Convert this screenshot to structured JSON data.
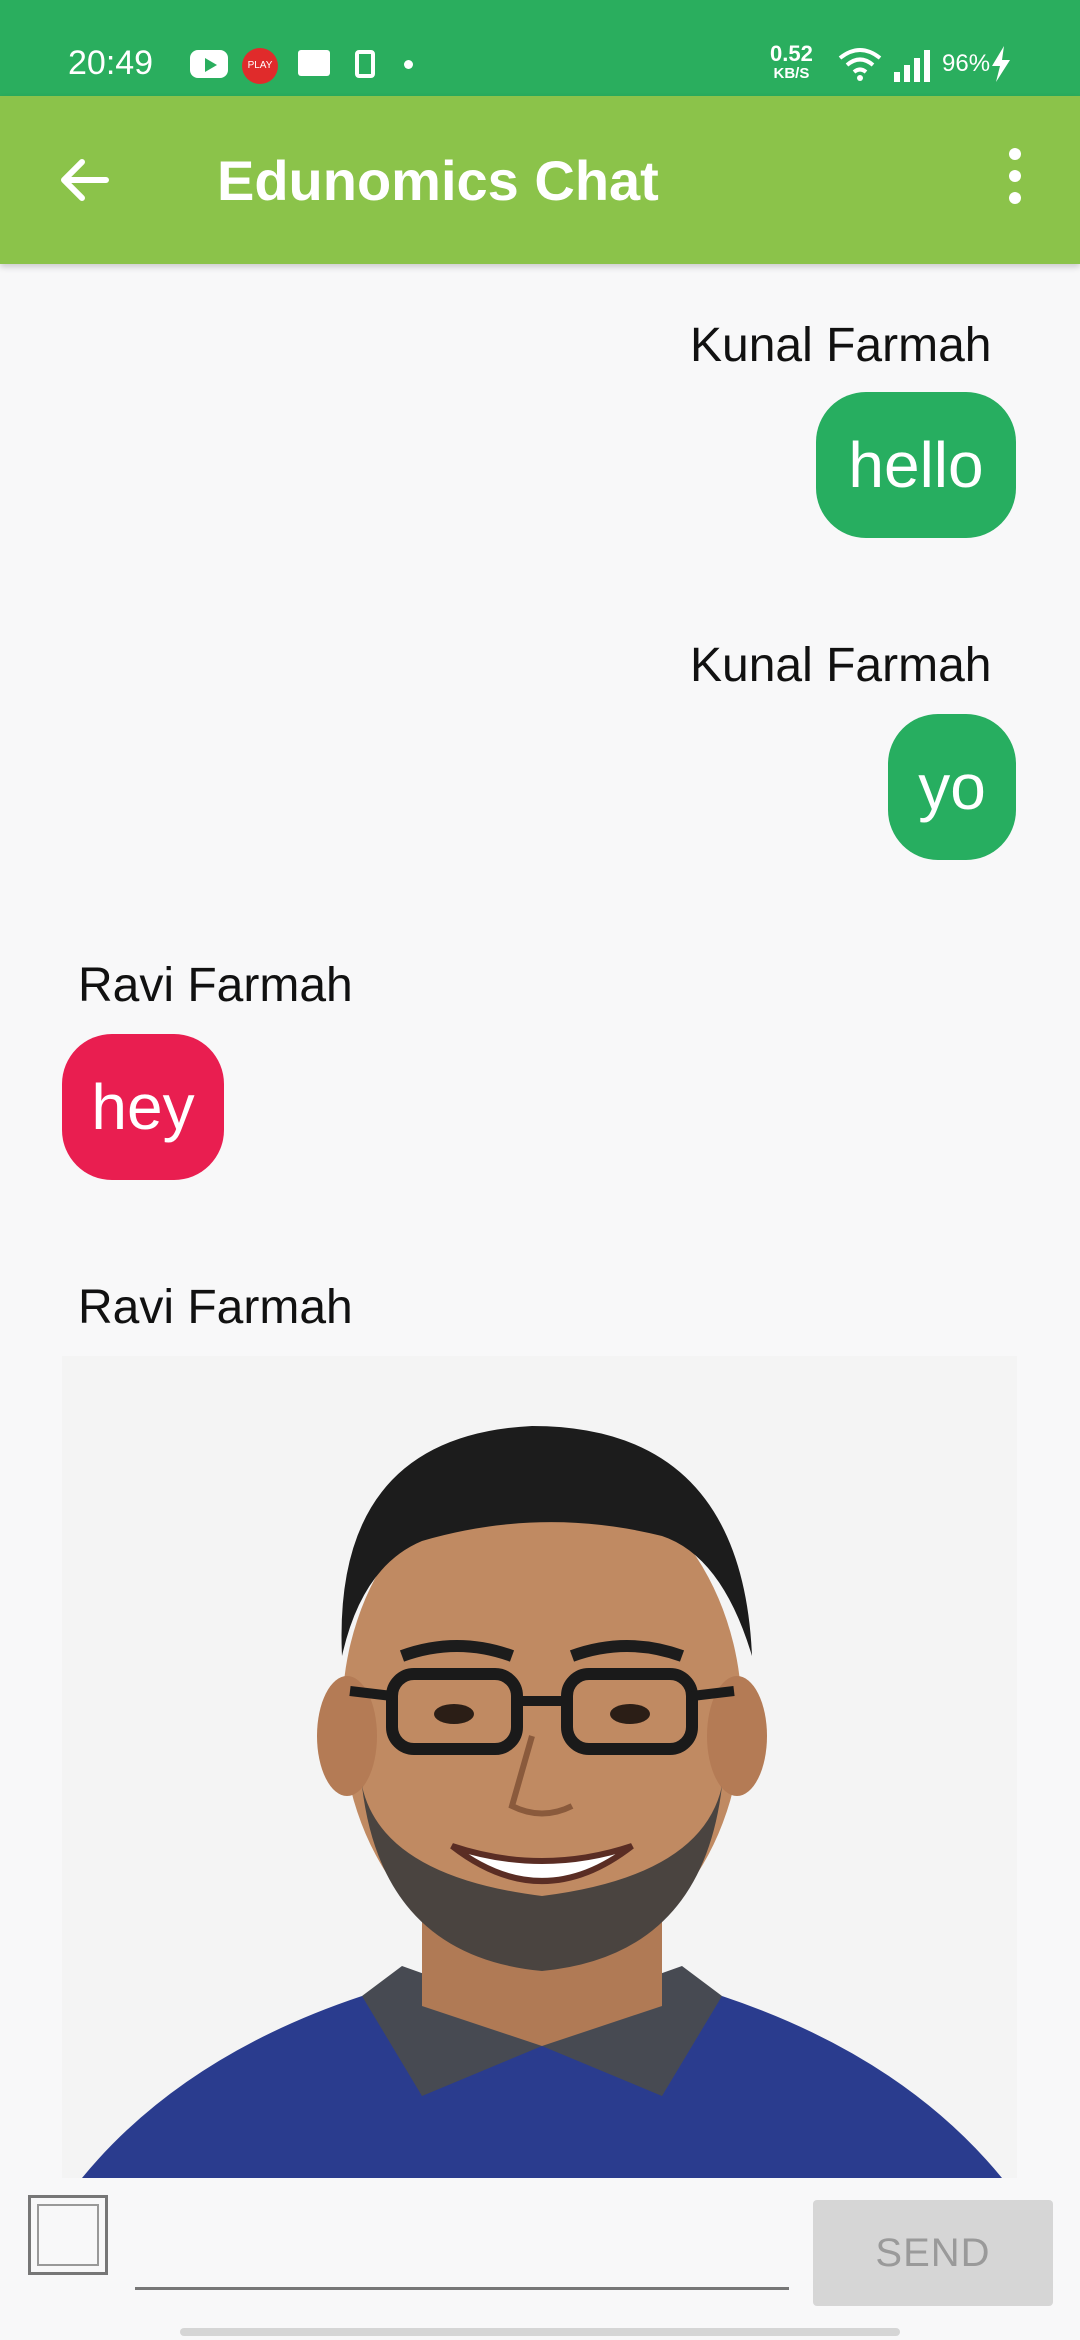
{
  "status_bar": {
    "time": "20:49",
    "play_badge": "PLAY",
    "net_speed": "0.52",
    "net_unit": "KB/S",
    "battery": "96%"
  },
  "app_bar": {
    "title": "Edunomics Chat"
  },
  "messages": [
    {
      "sender": "Kunal Farmah",
      "text": "hello",
      "direction": "outgoing"
    },
    {
      "sender": "Kunal Farmah",
      "text": "yo",
      "direction": "outgoing"
    },
    {
      "sender": "Ravi Farmah",
      "text": "hey",
      "direction": "incoming"
    },
    {
      "sender": "Ravi Farmah",
      "type": "image",
      "direction": "incoming"
    }
  ],
  "composer": {
    "placeholder": "",
    "send_label": "SEND"
  },
  "colors": {
    "status_bar": "#2aae5e",
    "app_bar": "#8bc34a",
    "outgoing_bubble": "#27ae60",
    "incoming_bubble": "#e91e50",
    "background": "#f8f8f9"
  }
}
